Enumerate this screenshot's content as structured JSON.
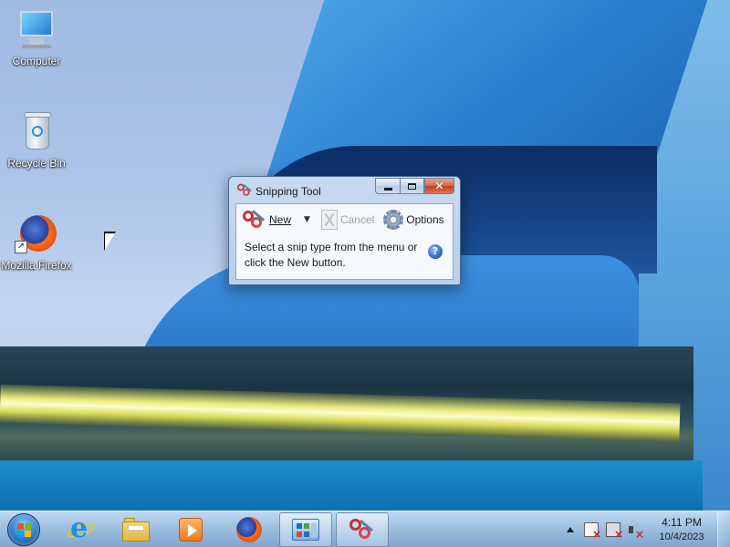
{
  "desktop": {
    "icons": [
      {
        "label": "Computer",
        "icon": "computer-icon"
      },
      {
        "label": "Recycle Bin",
        "icon": "recycle-bin-icon"
      },
      {
        "label": "Mozilla Firefox",
        "icon": "firefox-icon"
      }
    ]
  },
  "window": {
    "title": "Snipping Tool",
    "controls": {
      "minimize": "minimize",
      "maximize": "maximize",
      "close": "close"
    },
    "toolbar": {
      "new_label": "New",
      "cancel_label": "Cancel",
      "options_label": "Options"
    },
    "hint": "Select a snip type from the menu or click the New button.",
    "help_glyph": "?"
  },
  "taskbar": {
    "pinned": [
      {
        "name": "Start",
        "icon": "windows-start-orb"
      },
      {
        "name": "Internet Explorer",
        "icon": "internet-explorer-icon"
      },
      {
        "name": "Windows Explorer",
        "icon": "folder-icon"
      },
      {
        "name": "Windows Media Player",
        "icon": "media-player-icon"
      },
      {
        "name": "Mozilla Firefox",
        "icon": "firefox-icon"
      },
      {
        "name": "Control Panel",
        "icon": "control-panel-icon",
        "active": true
      },
      {
        "name": "Snipping Tool",
        "icon": "snipping-tool-icon",
        "active": true
      }
    ],
    "tray": {
      "time": "4:11 PM",
      "date": "10/4/2023"
    }
  }
}
